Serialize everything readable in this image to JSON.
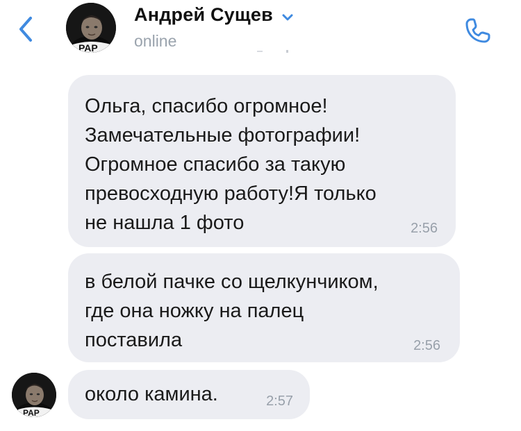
{
  "header": {
    "contact_name": "Андрей Сущев",
    "status": "online",
    "back_icon": "chevron-left-icon",
    "call_icon": "phone-icon",
    "dropdown_icon": "chevron-down-icon",
    "accent_color": "#3f8ae0"
  },
  "messages": [
    {
      "text": "Ольга, спасибо огромное!\nЗамечательные фотографии!\nОгромное спасибо за такую\nпревосходную работу!Я только\nне нашла 1 фото",
      "time": "2:56"
    },
    {
      "text": "в белой пачке со щелкунчиком,\nгде она ножку на палец\nпоставила",
      "time": "2:56"
    },
    {
      "text": "около камина.",
      "time": "2:57"
    }
  ],
  "colors": {
    "bubble_bg": "#ecedf2",
    "time_text": "#98a0aa",
    "status_text": "#9aa3ad"
  }
}
